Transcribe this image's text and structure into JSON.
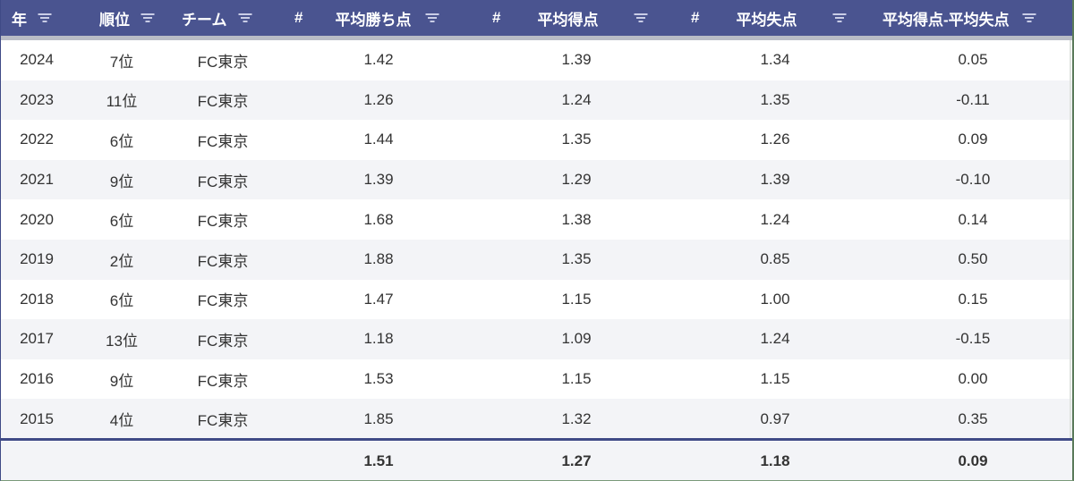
{
  "header": {
    "year": "年",
    "rank": "順位",
    "team": "チーム",
    "hash": "#",
    "avg_win_points": "平均勝ち点",
    "avg_goals_for": "平均得点",
    "avg_goals_against": "平均失点",
    "avg_goal_diff": "平均得点-平均失点"
  },
  "rows": [
    {
      "year": "2024",
      "rank": "7位",
      "team": "FC東京",
      "pts": "1.42",
      "gf": "1.39",
      "ga": "1.34",
      "diff": "0.05"
    },
    {
      "year": "2023",
      "rank": "11位",
      "team": "FC東京",
      "pts": "1.26",
      "gf": "1.24",
      "ga": "1.35",
      "diff": "-0.11"
    },
    {
      "year": "2022",
      "rank": "6位",
      "team": "FC東京",
      "pts": "1.44",
      "gf": "1.35",
      "ga": "1.26",
      "diff": "0.09"
    },
    {
      "year": "2021",
      "rank": "9位",
      "team": "FC東京",
      "pts": "1.39",
      "gf": "1.29",
      "ga": "1.39",
      "diff": "-0.10"
    },
    {
      "year": "2020",
      "rank": "6位",
      "team": "FC東京",
      "pts": "1.68",
      "gf": "1.38",
      "ga": "1.24",
      "diff": "0.14"
    },
    {
      "year": "2019",
      "rank": "2位",
      "team": "FC東京",
      "pts": "1.88",
      "gf": "1.35",
      "ga": "0.85",
      "diff": "0.50"
    },
    {
      "year": "2018",
      "rank": "6位",
      "team": "FC東京",
      "pts": "1.47",
      "gf": "1.15",
      "ga": "1.00",
      "diff": "0.15"
    },
    {
      "year": "2017",
      "rank": "13位",
      "team": "FC東京",
      "pts": "1.18",
      "gf": "1.09",
      "ga": "1.24",
      "diff": "-0.15"
    },
    {
      "year": "2016",
      "rank": "9位",
      "team": "FC東京",
      "pts": "1.53",
      "gf": "1.15",
      "ga": "1.15",
      "diff": "0.00"
    },
    {
      "year": "2015",
      "rank": "4位",
      "team": "FC東京",
      "pts": "1.85",
      "gf": "1.32",
      "ga": "0.97",
      "diff": "0.35"
    }
  ],
  "footer": {
    "pts": "1.51",
    "gf": "1.27",
    "ga": "1.18",
    "diff": "0.09"
  },
  "colors": {
    "header_bg": "#4a5490",
    "row_alt_bg": "#f3f4f7",
    "text": "#333333"
  },
  "icons": {
    "filter": "filter-icon"
  }
}
